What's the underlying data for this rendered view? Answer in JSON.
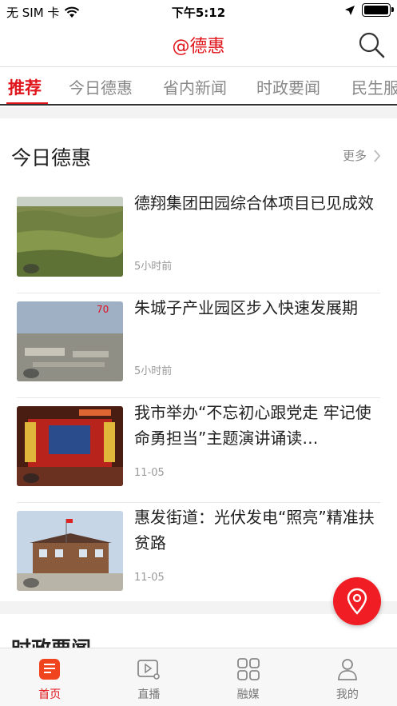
{
  "status_bar": {
    "carrier": "无 SIM 卡",
    "time": "下午5:12",
    "icons": [
      "wifi-icon",
      "location-arrow-icon",
      "battery-icon"
    ]
  },
  "nav": {
    "title": "@德惠",
    "search_icon": "search-icon"
  },
  "tabs": [
    {
      "label": "推荐",
      "active": true
    },
    {
      "label": "今日德惠",
      "active": false
    },
    {
      "label": "省内新闻",
      "active": false
    },
    {
      "label": "时政要闻",
      "active": false
    },
    {
      "label": "民生服",
      "active": false
    }
  ],
  "section": {
    "title": "今日德惠",
    "more_label": "更多"
  },
  "news": [
    {
      "title": "德翔集团田园综合体项目已见成效",
      "time": "5小时前",
      "thumb": "field-photo"
    },
    {
      "title": "朱城子产业园区步入快速发展期",
      "time": "5小时前",
      "thumb": "aerial-photo"
    },
    {
      "title": "我市举办“不忘初心跟党走 牢记使命勇担当”主题演讲诵读…",
      "time": "11-05",
      "thumb": "stage-photo"
    },
    {
      "title": "惠发街道：光伏发电“照亮”精准扶贫路",
      "time": "11-05",
      "thumb": "building-photo"
    }
  ],
  "section2_title": "时政要闻",
  "fab_icon": "location-pin-icon",
  "tabbar": [
    {
      "label": "首页",
      "icon": "news-icon",
      "active": true
    },
    {
      "label": "直播",
      "icon": "live-video-icon",
      "active": false
    },
    {
      "label": "融媒",
      "icon": "grid-icon",
      "active": false
    },
    {
      "label": "我的",
      "icon": "user-icon",
      "active": false
    }
  ],
  "colors": {
    "accent": "#e0151b",
    "fab": "#f01e24"
  }
}
